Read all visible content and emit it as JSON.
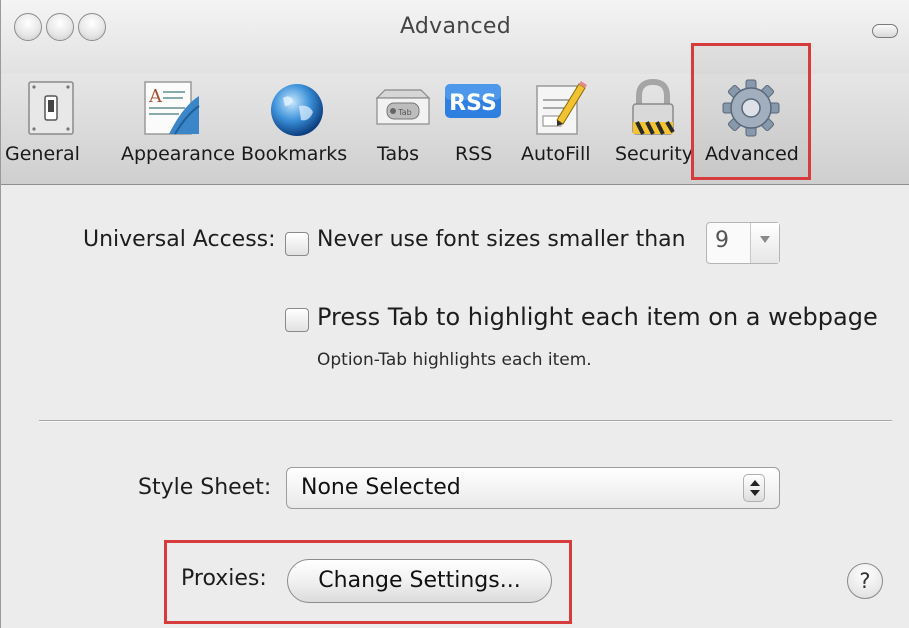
{
  "window": {
    "title": "Advanced"
  },
  "toolbar": {
    "items": [
      {
        "label": "General",
        "icon": "general-switch-icon"
      },
      {
        "label": "Appearance",
        "icon": "appearance-icon"
      },
      {
        "label": "Bookmarks",
        "icon": "globe-icon"
      },
      {
        "label": "Tabs",
        "icon": "tabs-icon"
      },
      {
        "label": "RSS",
        "icon": "rss-icon"
      },
      {
        "label": "AutoFill",
        "icon": "autofill-pencil-icon"
      },
      {
        "label": "Security",
        "icon": "padlock-icon"
      },
      {
        "label": "Advanced",
        "icon": "gear-icon"
      }
    ],
    "selected": "Advanced",
    "highlight_color": "#d63c3c"
  },
  "universal_access": {
    "label": "Universal Access:",
    "font_size_option": "Never use font sizes smaller than",
    "font_size_value": "9",
    "tab_option": "Press Tab to highlight each item on a webpage",
    "tab_note": "Option-Tab highlights each item."
  },
  "style_sheet": {
    "label": "Style Sheet:",
    "value": "None Selected"
  },
  "proxies": {
    "label": "Proxies:",
    "button": "Change Settings..."
  },
  "help": {
    "glyph": "?"
  },
  "icons": {
    "rss_text": "RSS",
    "tabs_text": "Tab"
  }
}
